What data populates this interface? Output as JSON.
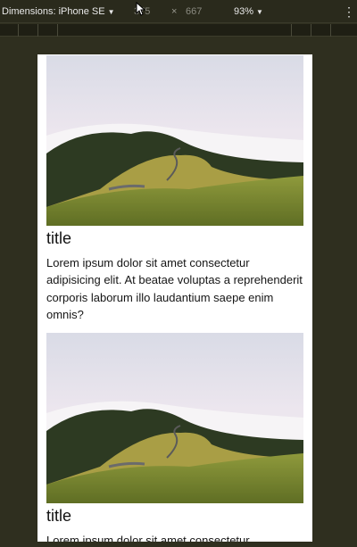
{
  "toolbar": {
    "dimensions_label": "Dimensions: iPhone SE",
    "width_value": "375",
    "times": "×",
    "height_value": "667",
    "zoom_value": "93%",
    "menu_glyph": "⋮"
  },
  "cards": [
    {
      "title": "title",
      "text": "Lorem ipsum dolor sit amet consectetur adipisicing elit. At beatae voluptas a reprehenderit corporis laborum illo laudantium saepe enim omnis?",
      "image_alt": "landscape-photo"
    },
    {
      "title": "title",
      "text": "Lorem ipsum dolor sit amet consectetur",
      "image_alt": "landscape-photo"
    }
  ],
  "colors": {
    "page_background": "#2f2f1f",
    "viewport_background": "#ffffff",
    "text": "#151515"
  }
}
